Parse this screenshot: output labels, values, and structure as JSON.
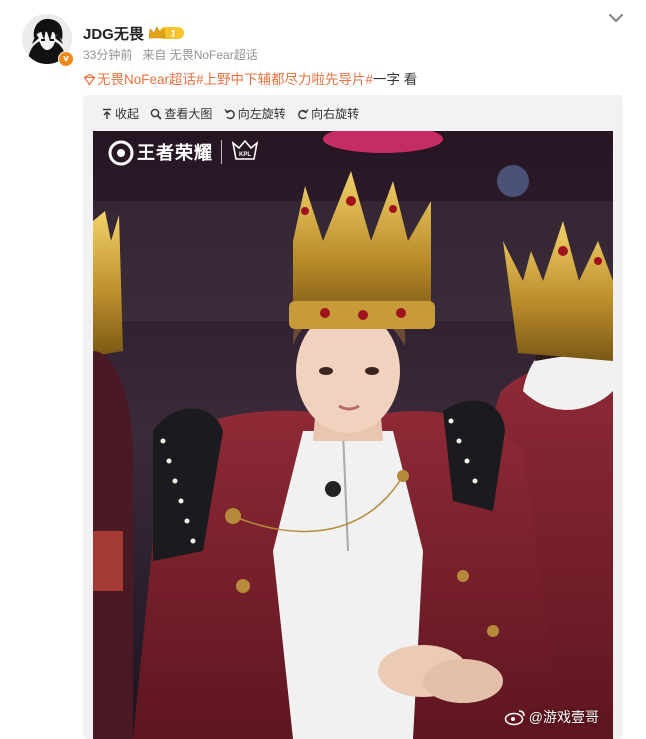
{
  "user": {
    "name": "JDG无畏",
    "level": "1",
    "verified_badge": "v"
  },
  "meta": {
    "time": "33分钟前",
    "source": "来自 无畏NoFear超话"
  },
  "post": {
    "topic": "无畏NoFear超话#上野中下辅都尽力啦先导片#",
    "text": "一字 看"
  },
  "toolbar": {
    "collapse": "收起",
    "view_large": "查看大图",
    "rotate_left": "向左旋转",
    "rotate_right": "向右旋转"
  },
  "photo": {
    "brand": "王者荣耀",
    "league": "KPL",
    "watermark": "@游戏壹哥"
  },
  "icons": {
    "menu": "chevron-down-icon",
    "topic": "topic-icon",
    "collapse": "collapse-icon",
    "view": "magnifier-icon",
    "rotate_left": "rotate-left-icon",
    "rotate_right": "rotate-right-icon"
  },
  "colors": {
    "topic": "#eb7340",
    "meta": "#939393",
    "verified": "#f08a1c",
    "level_gold": "#f5c32c"
  }
}
